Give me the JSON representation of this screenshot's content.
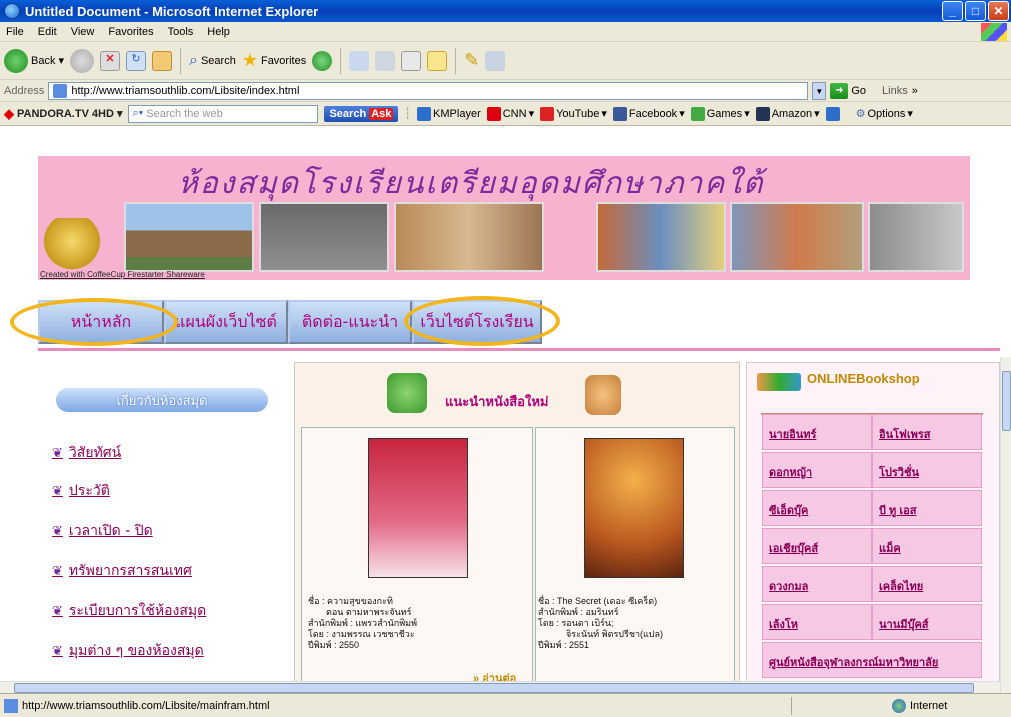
{
  "window": {
    "title": "Untitled Document - Microsoft Internet Explorer"
  },
  "menu": [
    "File",
    "Edit",
    "View",
    "Favorites",
    "Tools",
    "Help"
  ],
  "toolbar": {
    "back": "Back",
    "search": "Search",
    "favorites": "Favorites"
  },
  "address": {
    "label": "Address",
    "url": "http://www.triamsouthlib.com/Libsite/index.html",
    "go": "Go",
    "links": "Links"
  },
  "pandora": {
    "brand": "PANDORA.TV",
    "brand_suffix": "4HD",
    "search_placeholder": "Search the web",
    "search_button": "Search",
    "items": [
      "KMPlayer",
      "CNN",
      "YouTube",
      "Facebook",
      "Games",
      "Amazon"
    ],
    "options": "Options"
  },
  "banner": {
    "title": "ห้องสมุดโรงเรียนเตรียมอุดมศึกษาภาคใต้",
    "credit": "Created with CoffeeCup Firestarter Shareware"
  },
  "nav": {
    "home": "หน้าหลัก",
    "sitemap": "แผนผังเว็บไซต์",
    "contact": "ติดต่อ-แนะนำ",
    "school": "เว็บไซต์โรงเรียน"
  },
  "left": {
    "heading": "เกี่ยวกับห้องสมุด",
    "items": [
      "วิสัยทัศน์",
      "ประวัติ",
      "เวลาเปิด - ปิด",
      "ทรัพยากรสารสนเทศ",
      "ระเบียบการใช้ห้องสมุด",
      "มุมต่าง ๆ ของห้องสมุด"
    ]
  },
  "middle": {
    "heading": "แนะนำหนังสือใหม่",
    "book1": [
      "ชื่อ : ความสุขของกะทิ",
      "ตอน ตามหาพระจันทร์",
      "สำนักพิมพ์ : แพรวสำนักพิมพ์",
      "โดย : งามพรรณ เวชชาชีวะ",
      "ปีพิมพ์ : 2550"
    ],
    "book2": [
      "ชื่อ : The Secret (เดอะ ซีเคร็ต)",
      "สำนักพิมพ์ : อมรินทร์",
      "โดย : รอนดา เบิร์น;",
      "จิระนันท์ พิตรปรีชา(แปล)",
      "ปีพิมพ์ : 2551"
    ],
    "more": "อ่านต่อ"
  },
  "right": {
    "heading_pre": "ONLINE",
    "heading_post": "Bookshop",
    "shops": [
      "นายอินทร์",
      "อินโฟเพรส",
      "ดอกหญ้า",
      "โปรวิชั่น",
      "ซีเอ็ดบุ๊ค",
      "บี ทู เอส",
      "เอเชียบุ๊คส์",
      "แม็ค",
      "ดวงกมล",
      "เคล็ดไทย",
      "เล้งโห",
      "นานมีบุ๊คส์"
    ],
    "last": "ศูนย์หนังสือจุฬาลงกรณ์มหาวิทยาลัย"
  },
  "status": {
    "url": "http://www.triamsouthlib.com/Libsite/mainfram.html",
    "zone": "Internet"
  }
}
